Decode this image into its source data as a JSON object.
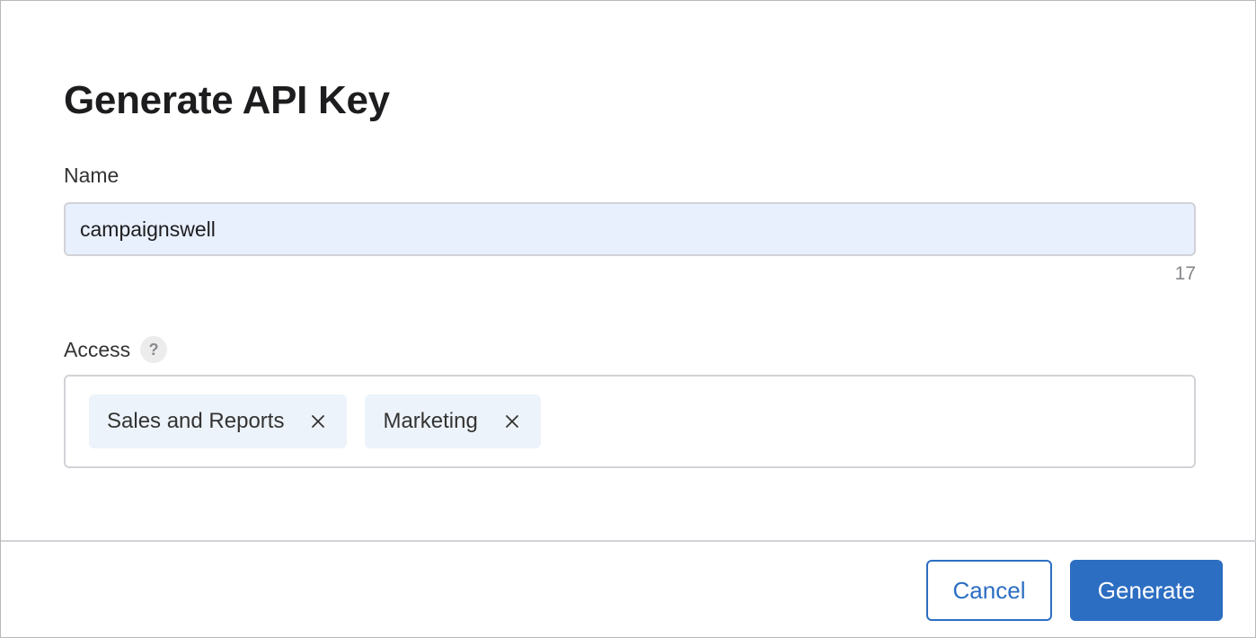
{
  "dialog": {
    "title": "Generate API Key"
  },
  "name_field": {
    "label": "Name",
    "value": "campaignswell",
    "char_count": "17"
  },
  "access_field": {
    "label": "Access",
    "help_glyph": "?",
    "tags": [
      {
        "label": "Sales and Reports"
      },
      {
        "label": "Marketing"
      }
    ]
  },
  "footer": {
    "cancel_label": "Cancel",
    "generate_label": "Generate"
  },
  "colors": {
    "accent": "#2c6ec2",
    "input_autofill_bg": "#e8f0fe",
    "tag_bg": "#edf3fa"
  },
  "icons": {
    "help": "help-icon",
    "tag_remove": "close-icon"
  }
}
